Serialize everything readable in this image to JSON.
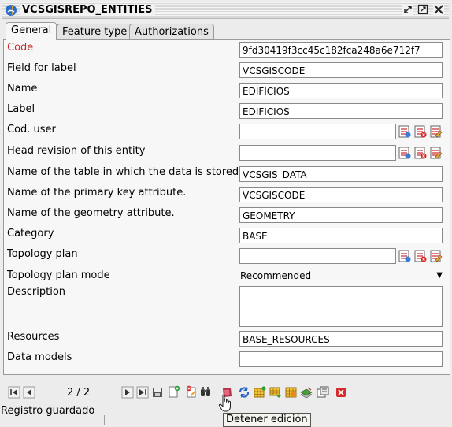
{
  "window": {
    "title": "VCSGISREPO_ENTITIES"
  },
  "tabs": [
    {
      "label": "General",
      "active": true
    },
    {
      "label": "Feature type",
      "active": false
    },
    {
      "label": "Authorizations",
      "active": false
    }
  ],
  "form": {
    "code": {
      "label": "Code",
      "value": "9fd30419f3cc45c182fca248a6e712f7"
    },
    "field_for_label": {
      "label": "Field for label",
      "value": "VCSGISCODE"
    },
    "name": {
      "label": "Name",
      "value": "EDIFICIOS"
    },
    "label": {
      "label": "Label",
      "value": "EDIFICIOS"
    },
    "cod_user": {
      "label": "Cod. user",
      "value": ""
    },
    "head_revision": {
      "label": "Head revision of this entity",
      "value": ""
    },
    "table_name": {
      "label": "Name of the table in which the data is stored",
      "value": "VCSGIS_DATA"
    },
    "pk_attr": {
      "label": "Name of the primary key attribute.",
      "value": "VCSGISCODE"
    },
    "geom_attr": {
      "label": "Name of the geometry attribute.",
      "value": "GEOMETRY"
    },
    "category": {
      "label": "Category",
      "value": "BASE"
    },
    "topology_plan": {
      "label": "Topology plan",
      "value": ""
    },
    "topology_plan_mode": {
      "label": "Topology plan mode",
      "value": "Recommended"
    },
    "description": {
      "label": "Description",
      "value": ""
    },
    "resources": {
      "label": "Resources",
      "value": "BASE_RESOURCES"
    },
    "data_models": {
      "label": "Data models",
      "value": ""
    }
  },
  "navigation": {
    "position": "2 / 2"
  },
  "status": {
    "message": "Registro guardado"
  },
  "tooltip": {
    "text": "Detener edición"
  },
  "colors": {
    "required_label": "#c0302b",
    "panel": "#f7f7f7",
    "window": "#ececec"
  }
}
